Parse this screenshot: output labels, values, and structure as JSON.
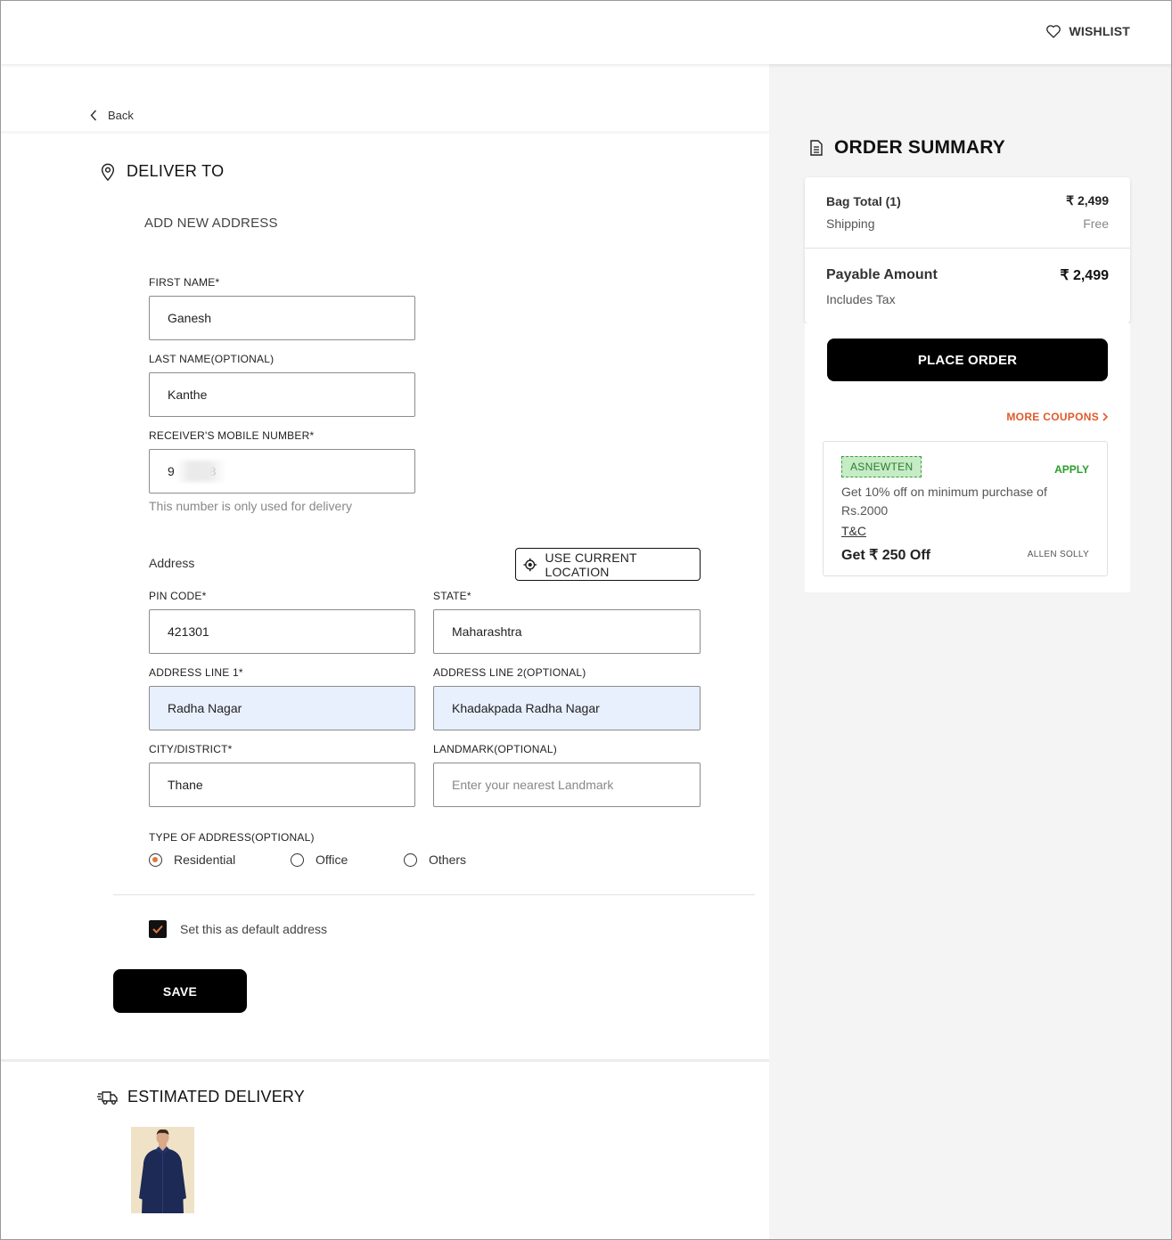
{
  "header": {
    "wishlist_label": "WISHLIST"
  },
  "nav": {
    "back_label": "Back"
  },
  "deliver": {
    "title": "DELIVER TO",
    "add_new": "ADD NEW ADDRESS"
  },
  "form": {
    "first_name": {
      "label": "FIRST NAME*",
      "value": "Ganesh"
    },
    "last_name": {
      "label": "LAST NAME(OPTIONAL)",
      "value": "Kanthe"
    },
    "mobile": {
      "label": "RECEIVER'S MOBILE NUMBER*",
      "value": "9          8",
      "helper": "This number is only used for delivery"
    },
    "address_heading": "Address",
    "use_location": "USE CURRENT LOCATION",
    "pin": {
      "label": "PIN CODE*",
      "value": "421301"
    },
    "state": {
      "label": "STATE*",
      "value": "Maharashtra"
    },
    "line1": {
      "label": "ADDRESS LINE 1*",
      "value": "Radha Nagar"
    },
    "line2": {
      "label": "ADDRESS LINE 2(OPTIONAL)",
      "value": "Khadakpada Radha Nagar"
    },
    "city": {
      "label": "CITY/DISTRICT*",
      "value": "Thane"
    },
    "landmark": {
      "label": "LANDMARK(OPTIONAL)",
      "value": "",
      "placeholder": "Enter your nearest Landmark"
    },
    "type_label": "TYPE OF ADDRESS(OPTIONAL)",
    "types": [
      {
        "label": "Residential",
        "selected": true
      },
      {
        "label": "Office",
        "selected": false
      },
      {
        "label": "Others",
        "selected": false
      }
    ],
    "default_label": "Set this as default address",
    "default_checked": true,
    "save_label": "SAVE"
  },
  "delivery": {
    "title": "ESTIMATED DELIVERY"
  },
  "summary": {
    "title": "ORDER SUMMARY",
    "bag_total_label": "Bag Total (1)",
    "bag_total": "₹ 2,499",
    "shipping_label": "Shipping",
    "shipping_value": "Free",
    "payable_label": "Payable Amount",
    "payable_value": "₹ 2,499",
    "tax_label": "Includes Tax",
    "place_order": "PLACE ORDER",
    "more_coupons": "MORE COUPONS",
    "coupon": {
      "code": "ASNEWTEN",
      "apply": "APPLY",
      "description": "Get 10% off on minimum purchase of Rs.2000",
      "tnc": "T&C",
      "saving": "Get ₹ 250 Off",
      "brand": "ALLEN SOLLY"
    }
  },
  "colors": {
    "accent": "#e0592a",
    "apply_green": "#2a9d2a",
    "primary_button": "#000000",
    "radio_selected": "#e0783c"
  }
}
